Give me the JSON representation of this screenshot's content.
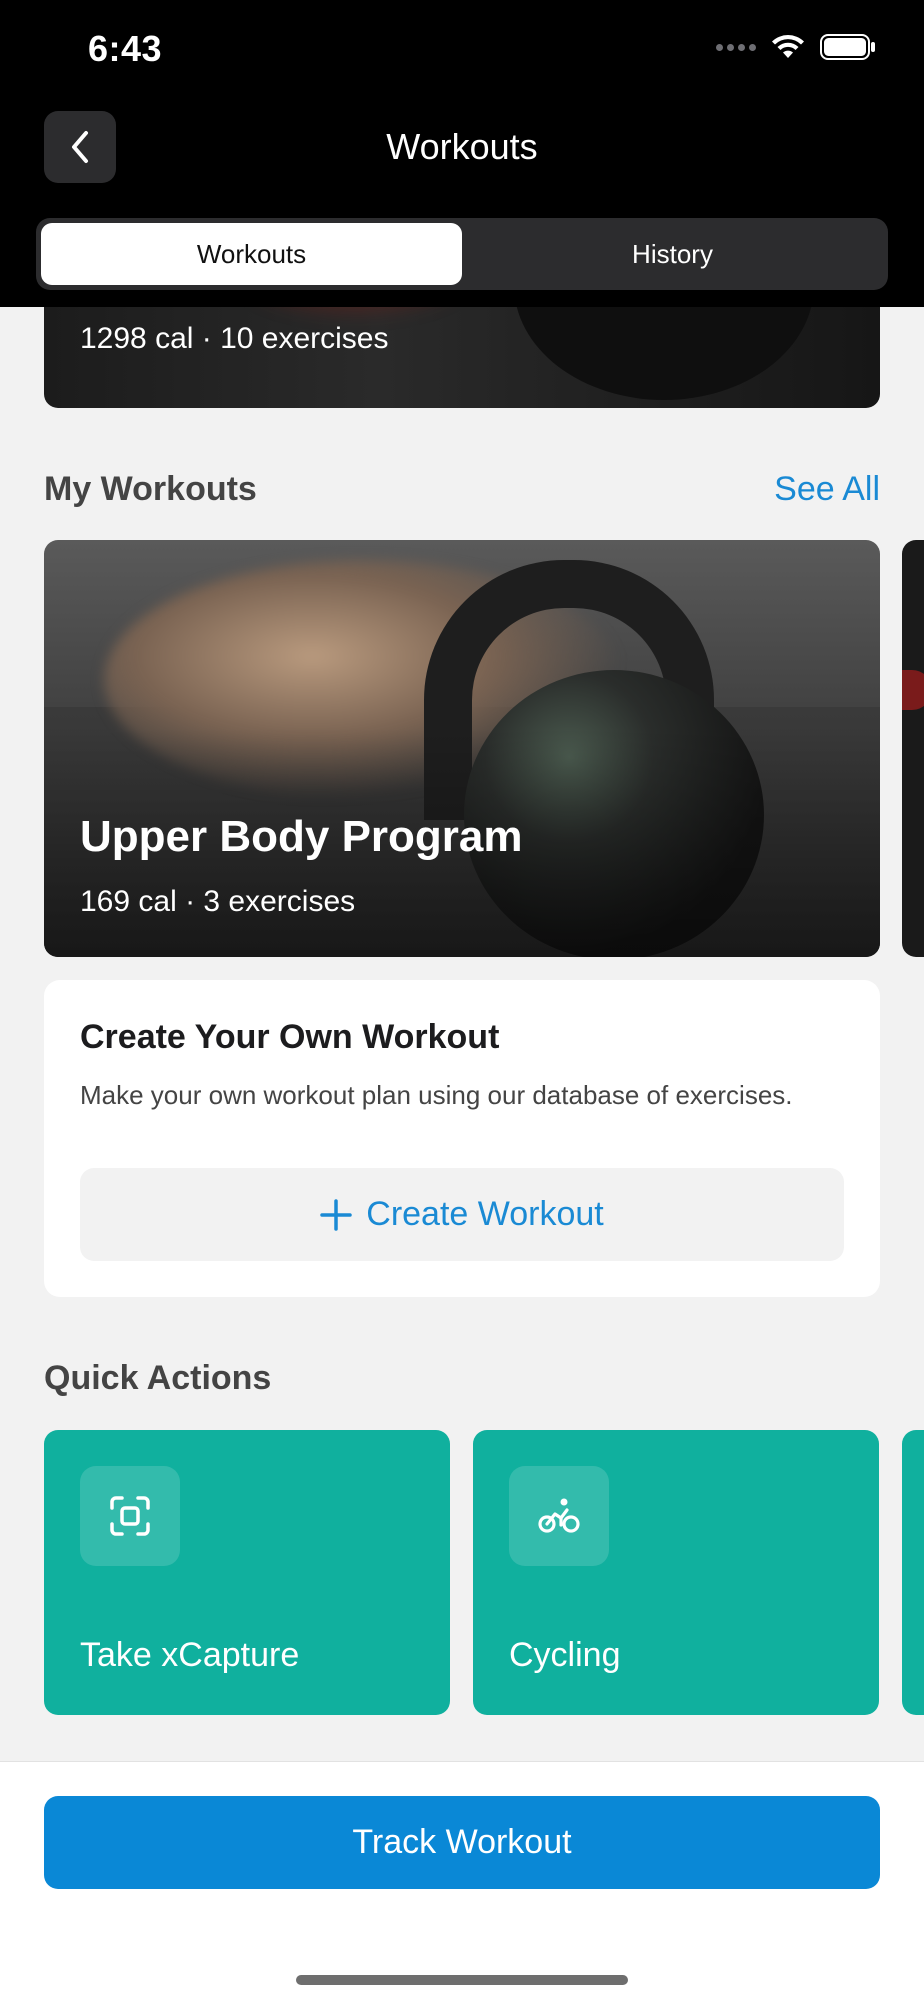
{
  "status_bar": {
    "time": "6:43"
  },
  "header": {
    "title": "Workouts",
    "tabs": [
      {
        "label": "Workouts",
        "active": true
      },
      {
        "label": "History",
        "active": false
      }
    ]
  },
  "featured": {
    "meta": "1298 cal · 10 exercises"
  },
  "my_workouts": {
    "title": "My Workouts",
    "see_all": "See All",
    "cards": [
      {
        "title": "Upper Body Program",
        "meta": "169 cal · 3 exercises"
      }
    ]
  },
  "create_workout": {
    "title": "Create Your Own Workout",
    "description": "Make your own workout plan using our database of exercises.",
    "button_label": "Create Workout"
  },
  "quick_actions": {
    "title": "Quick Actions",
    "items": [
      {
        "label": "Take xCapture",
        "icon": "scan-icon"
      },
      {
        "label": "Cycling",
        "icon": "cycling-icon"
      }
    ]
  },
  "bottom": {
    "track_button": "Track Workout"
  },
  "colors": {
    "accent_blue": "#0a88d6",
    "link_blue": "#1a8ad4",
    "teal": "#10b09e"
  }
}
